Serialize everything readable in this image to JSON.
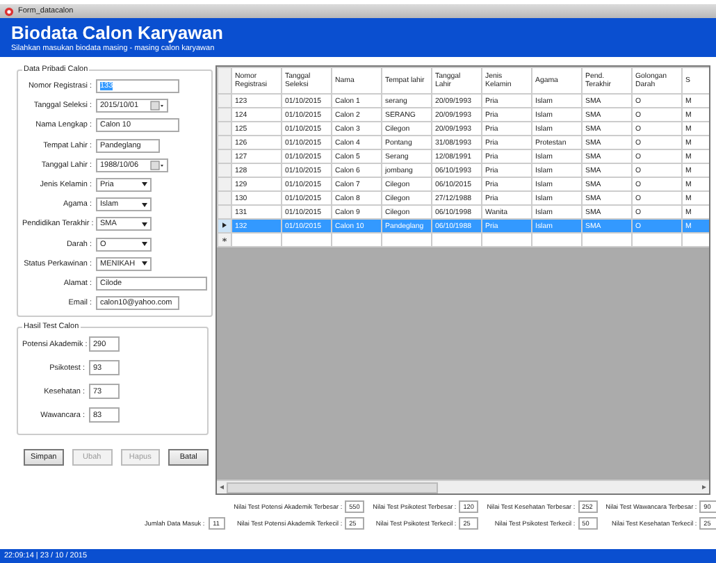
{
  "window": {
    "title": "Form_datacalon"
  },
  "header": {
    "title": "Biodata Calon Karyawan",
    "subtitle": "Silahkan masukan biodata masing - masing calon karyawan"
  },
  "personal": {
    "title": "Data Pribadi Calon",
    "fields": [
      {
        "label": "Nomor Registrasi :",
        "value": "133",
        "kind": "text",
        "text_selected": true
      },
      {
        "label": "Tanggal Seleksi :",
        "value": "2015/10/01",
        "kind": "date",
        "text_selected": false
      },
      {
        "label": "Nama Lengkap :",
        "value": "Calon 10",
        "kind": "text",
        "text_selected": false
      },
      {
        "label": "Tempat Lahir :",
        "value": "Pandeglang",
        "kind": "text",
        "text_selected": false
      },
      {
        "label": "Tanggal Lahir :",
        "value": "1988/10/06",
        "kind": "date",
        "text_selected": false
      },
      {
        "label": "Jenis Kelamin :",
        "value": "Pria",
        "kind": "combo",
        "text_selected": false
      },
      {
        "label": "Agama :",
        "value": "Islam",
        "kind": "combo",
        "text_selected": false
      },
      {
        "label": "Pendidikan Terakhir :",
        "value": "SMA",
        "kind": "combo",
        "text_selected": false
      },
      {
        "label": "Darah :",
        "value": "O",
        "kind": "combo",
        "text_selected": false
      },
      {
        "label": "Status Perkawinan :",
        "value": "MENIKAH",
        "kind": "combo",
        "text_selected": false
      },
      {
        "label": "Alamat :",
        "value": "Cilode",
        "kind": "text",
        "text_selected": false
      },
      {
        "label": "Email :",
        "value": "calon10@yahoo.com",
        "kind": "text",
        "text_selected": false
      }
    ]
  },
  "tests": {
    "title": "Hasil Test Calon",
    "fields": [
      {
        "label": "Potensi Akademik :",
        "value": "290"
      },
      {
        "label": "Psikotest :",
        "value": "93"
      },
      {
        "label": "Kesehatan :",
        "value": "73"
      },
      {
        "label": "Wawancara :",
        "value": "83"
      }
    ]
  },
  "buttons": [
    {
      "label": "Simpan",
      "disabled": false
    },
    {
      "label": "Ubah",
      "disabled": true
    },
    {
      "label": "Hapus",
      "disabled": true
    },
    {
      "label": "Batal",
      "disabled": false
    }
  ],
  "table": {
    "columns": [
      "Nomor Registrasi",
      "Tanggal Seleksi",
      "Nama",
      "Tempat lahir",
      "Tanggal Lahir",
      "Jenis Kelamin",
      "Agama",
      "Pend. Terakhir",
      "Golongan Darah",
      "S"
    ],
    "rows": [
      {
        "selected": false,
        "cells": [
          "123",
          "01/10/2015",
          "Calon 1",
          "serang",
          "20/09/1993",
          "Pria",
          "Islam",
          "SMA",
          "O",
          "M"
        ]
      },
      {
        "selected": false,
        "cells": [
          "124",
          "01/10/2015",
          "Calon 2",
          "SERANG",
          "20/09/1993",
          "Pria",
          "Islam",
          "SMA",
          "O",
          "M"
        ]
      },
      {
        "selected": false,
        "cells": [
          "125",
          "01/10/2015",
          "Calon 3",
          "Cilegon",
          "20/09/1993",
          "Pria",
          "Islam",
          "SMA",
          "O",
          "M"
        ]
      },
      {
        "selected": false,
        "cells": [
          "126",
          "01/10/2015",
          "Calon 4",
          "Pontang",
          "31/08/1993",
          "Pria",
          "Protestan",
          "SMA",
          "O",
          "M"
        ]
      },
      {
        "selected": false,
        "cells": [
          "127",
          "01/10/2015",
          "Calon 5",
          "Serang",
          "12/08/1991",
          "Pria",
          "Islam",
          "SMA",
          "O",
          "M"
        ]
      },
      {
        "selected": false,
        "cells": [
          "128",
          "01/10/2015",
          "Calon 6",
          "jombang",
          "06/10/1993",
          "Pria",
          "Islam",
          "SMA",
          "O",
          "M"
        ]
      },
      {
        "selected": false,
        "cells": [
          "129",
          "01/10/2015",
          "Calon 7",
          "Cilegon",
          "06/10/2015",
          "Pria",
          "Islam",
          "SMA",
          "O",
          "M"
        ]
      },
      {
        "selected": false,
        "cells": [
          "130",
          "01/10/2015",
          "Calon 8",
          "Cilegon",
          "27/12/1988",
          "Pria",
          "Islam",
          "SMA",
          "O",
          "M"
        ]
      },
      {
        "selected": false,
        "cells": [
          "131",
          "01/10/2015",
          "Calon 9",
          "Cilegon",
          "06/10/1998",
          "Wanita",
          "Islam",
          "SMA",
          "O",
          "M"
        ]
      },
      {
        "selected": true,
        "cells": [
          "132",
          "01/10/2015",
          "Calon 10",
          "Pandeglang",
          "06/10/1988",
          "Pria",
          "Islam",
          "SMA",
          "O",
          "M"
        ]
      }
    ]
  },
  "count": {
    "label": "Jumlah Data Masuk :",
    "value": "11"
  },
  "stats": [
    {
      "label": "Nilai Test Potensi Akademik Terbesar :",
      "value": "550"
    },
    {
      "label": "Nilai Test Psikotest Terbesar :",
      "value": "120"
    },
    {
      "label": "Nilai Test Kesehatan Terbesar :",
      "value": "252"
    },
    {
      "label": "Nilai Test Wawancara Terbesar :",
      "value": "90"
    },
    {
      "label": "Nilai Test Potensi Akademik Terkecil :",
      "value": "25"
    },
    {
      "label": "Nilai Test Psikotest Terkecil :",
      "value": "25"
    },
    {
      "label": "Nilai Test Psikotest Terkecil :",
      "value": "50"
    },
    {
      "label": "Nilai Test Kesehatan Terkecil :",
      "value": "25"
    }
  ],
  "status_bar": "22:09:14  |  23 / 10 / 2015"
}
